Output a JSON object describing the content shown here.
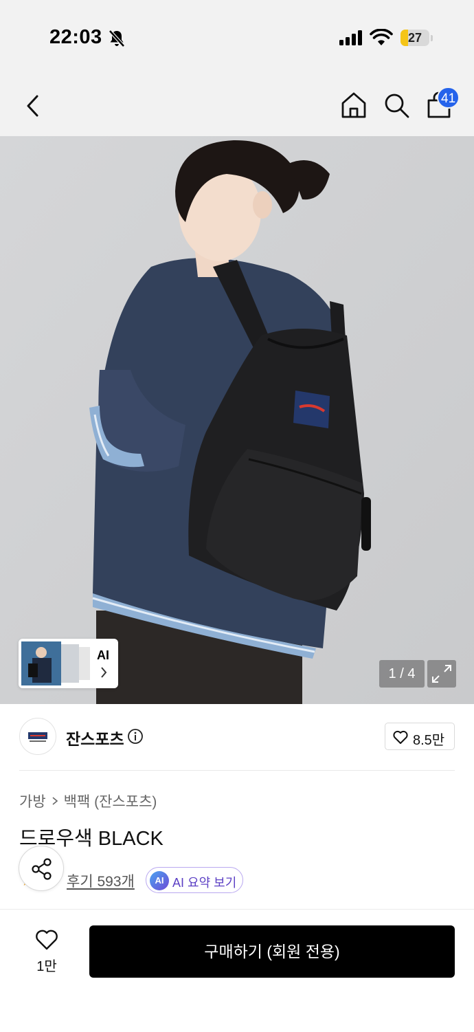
{
  "status_bar": {
    "time": "22:03",
    "battery": "27",
    "battery_level": 0.27
  },
  "nav": {
    "cart_count": "41"
  },
  "gallery": {
    "counter": "1 / 4",
    "ai_label": "AI"
  },
  "brand": {
    "name": "잔스포츠",
    "like_count": "8.5만"
  },
  "breadcrumb": {
    "category": "가방",
    "subcategory": "백팩 (잔스포츠)"
  },
  "product": {
    "title": "드로우색 BLACK",
    "review_link": "후기 593개",
    "ai_summary": "AI 요약 보기",
    "ai_badge": "AI"
  },
  "bottom_bar": {
    "wish_count": "1만",
    "buy_label": "구매하기 (회원 전용)"
  },
  "colors": {
    "buy_button": "#000000",
    "cart_badge": "#2563eb",
    "battery": "#f5c518",
    "ai_chip_text": "#5b3fc4"
  }
}
